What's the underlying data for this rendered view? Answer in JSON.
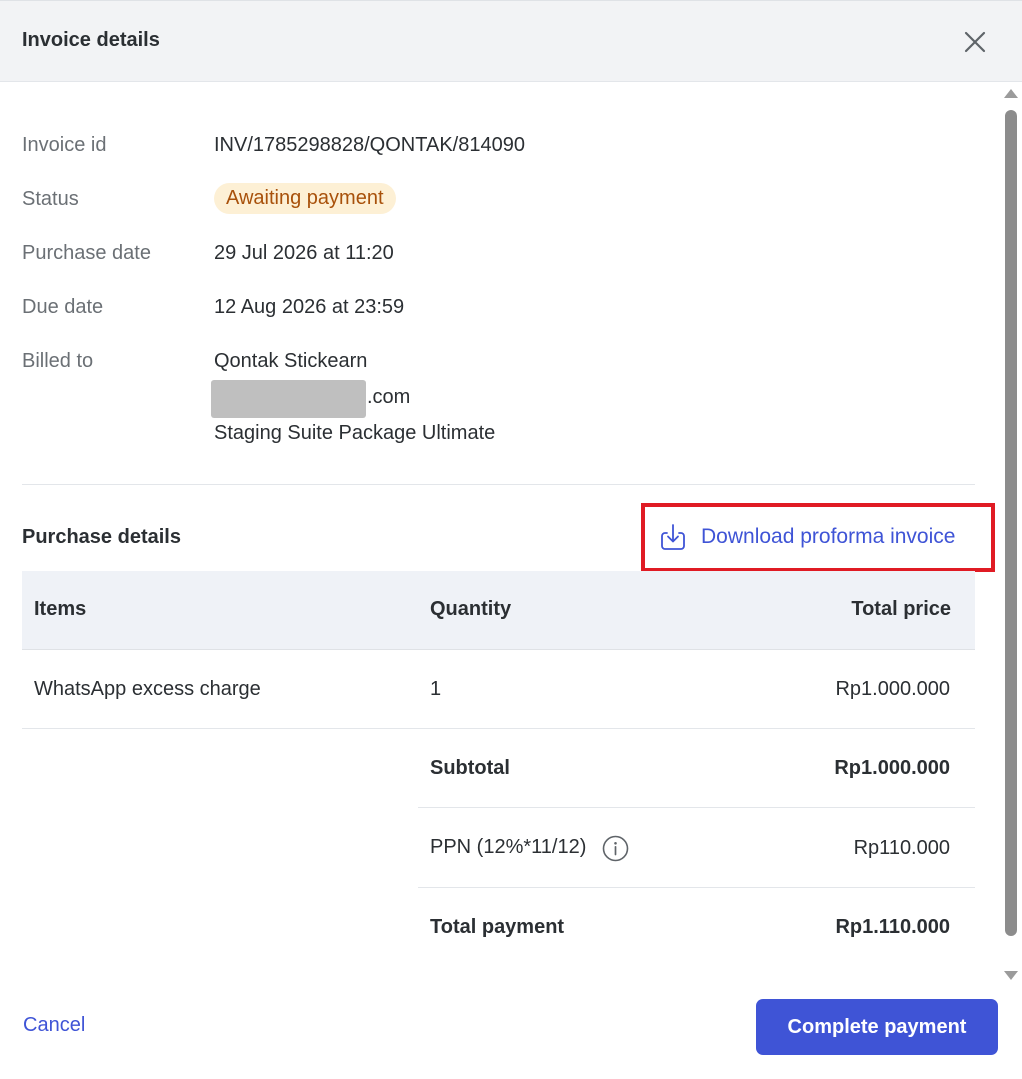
{
  "modal": {
    "title": "Invoice details"
  },
  "invoice": {
    "id_label": "Invoice id",
    "id_value": "INV/1785298828/QONTAK/814090",
    "status_label": "Status",
    "status_value": "Awaiting payment",
    "purchase_date_label": "Purchase date",
    "purchase_date_value": "29 Jul 2026 at 11:20",
    "due_date_label": "Due date",
    "due_date_value": "12 Aug 2026 at 23:59",
    "billed_to_label": "Billed to",
    "billed_to_name": "Qontak Stickearn",
    "billed_to_email_suffix": ".com",
    "billed_to_package": "Staging Suite Package Ultimate"
  },
  "purchase": {
    "section_title": "Purchase details",
    "download_label": "Download proforma invoice",
    "columns": {
      "items": "Items",
      "quantity": "Quantity",
      "total_price": "Total price"
    },
    "rows": [
      {
        "item": "WhatsApp excess charge",
        "quantity": "1",
        "total_price": "Rp1.000.000"
      }
    ],
    "subtotal_label": "Subtotal",
    "subtotal_value": "Rp1.000.000",
    "tax_label": "PPN (12%*11/12)",
    "tax_value": "Rp110.000",
    "total_label": "Total payment",
    "total_value": "Rp1.110.000"
  },
  "footer": {
    "cancel_label": "Cancel",
    "complete_label": "Complete payment"
  },
  "colors": {
    "accent": "#3f54d6",
    "status_bg": "#fdf0d5",
    "status_text": "#a8510b",
    "highlight_border": "#e01b24"
  },
  "icons": {
    "close": "close-icon",
    "download": "download-icon",
    "info": "info-icon"
  }
}
